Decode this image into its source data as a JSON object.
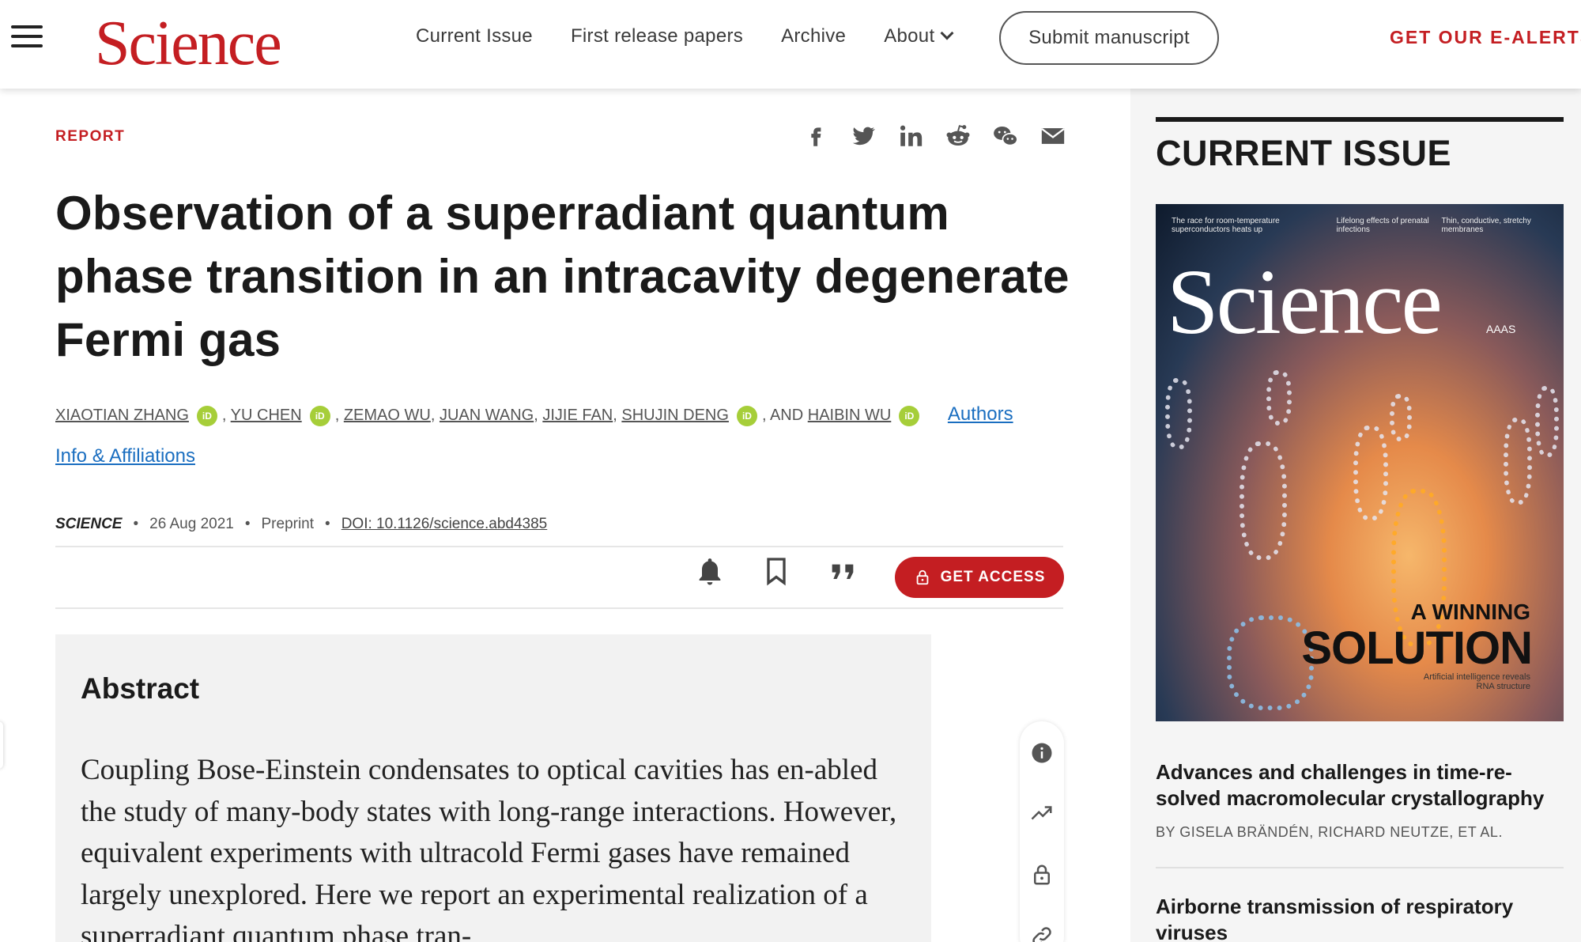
{
  "header": {
    "logo": "Science",
    "nav": {
      "current_issue": "Current Issue",
      "first_release": "First release papers",
      "archive": "Archive",
      "about": "About"
    },
    "submit_label": "Submit manuscript",
    "alerts_label": "GET OUR E-ALERTS"
  },
  "article": {
    "type_tag": "REPORT",
    "title": "Observation of a superradiant quantum phase transition in an intracavity degenerate Fermi gas",
    "authors": [
      {
        "name": "XIAOTIAN ZHANG",
        "orcid": true
      },
      {
        "name": "YU CHEN",
        "orcid": true
      },
      {
        "name": "ZEMAO WU",
        "orcid": false
      },
      {
        "name": "JUAN WANG",
        "orcid": false
      },
      {
        "name": "JIJIE FAN",
        "orcid": false
      },
      {
        "name": "SHUJIN DENG",
        "orcid": true
      },
      {
        "name": "HAIBIN WU",
        "orcid": true
      }
    ],
    "and_label": "AND",
    "orcid_label": "iD",
    "authors_info_label": "Authors Info & Affiliations",
    "journal": "SCIENCE",
    "date": "26 Aug 2021",
    "status": "Preprint",
    "doi": "DOI: 10.1126/science.abd4385",
    "get_access_label": "GET ACCESS",
    "abstract_heading": "Abstract",
    "abstract_text": "Coupling Bose-Einstein condensates to optical cavities has en-abled the study of many-body states with long-range interactions. However, equivalent experiments with ultracold Fermi gases have remained largely unexplored. Here we report an experimental realization of a superradiant quantum phase tran-"
  },
  "share_icons": [
    "facebook-icon",
    "twitter-icon",
    "linkedin-icon",
    "reddit-icon",
    "wechat-icon",
    "email-icon"
  ],
  "sidebar": {
    "heading": "CURRENT ISSUE",
    "cover": {
      "logo": "Science",
      "aaas": "AAAS",
      "headline_small": "A WINNING",
      "headline_big": "SOLUTION",
      "headline_sub": "Artificial intelligence reveals RNA structure",
      "top_items": [
        "The race for room-temperature superconductors heats up",
        "Lifelong effects of prenatal infections",
        "Thin, conductive, stretchy membranes"
      ]
    },
    "articles": [
      {
        "title": "Advances and challenges in time-re-solved macromolecular crystallography",
        "byline": "BY GISELA BRÄNDÉN, RICHARD NEUTZE, ET AL."
      },
      {
        "title": "Airborne transmission of respiratory viruses",
        "byline": ""
      }
    ]
  },
  "colors": {
    "brand_red": "#c41e22",
    "orcid_green": "#a6ce39",
    "link_blue": "#1a6ec0"
  }
}
